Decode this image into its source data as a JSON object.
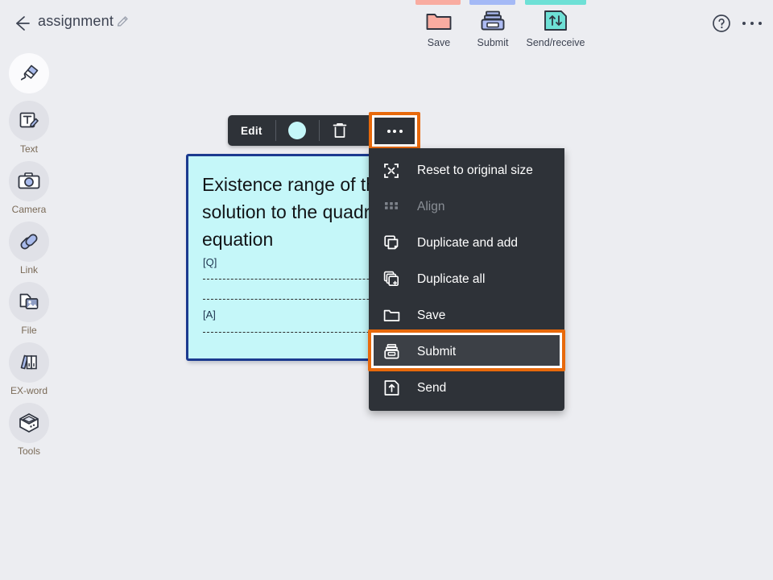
{
  "app": {
    "background_color": "#ecedf1",
    "accent_highlight_color": "#e8690b",
    "menu_background_color": "#2e3238"
  },
  "header": {
    "back_label": "back-arrow",
    "title": "assignment",
    "title_edit_icon": "pencil-icon",
    "help_icon": "help-circle-icon",
    "overflow_icon": "more-horizontal-icon",
    "stripes": [
      {
        "name": "save-stripe",
        "color": "#f9aca1"
      },
      {
        "name": "submit-stripe",
        "color": "#a4b9f6"
      },
      {
        "name": "send-receive-stripe",
        "color": "#6ee0d6"
      }
    ],
    "tools": [
      {
        "icon": "folder-icon",
        "label": "Save"
      },
      {
        "icon": "printer-icon",
        "label": "Submit"
      },
      {
        "icon": "send-receive-icon",
        "label": "Send/receive"
      }
    ]
  },
  "sidebar": {
    "items": [
      {
        "icon": "pen-icon",
        "label": "",
        "active": true
      },
      {
        "icon": "text-icon",
        "label": "Text",
        "active": false
      },
      {
        "icon": "camera-icon",
        "label": "Camera",
        "active": false
      },
      {
        "icon": "link-icon",
        "label": "Link",
        "active": false
      },
      {
        "icon": "file-icon",
        "label": "File",
        "active": false
      },
      {
        "icon": "dictionary-icon",
        "label": "EX-word",
        "active": false
      },
      {
        "icon": "tools-icon",
        "label": "Tools",
        "active": false
      }
    ]
  },
  "note": {
    "title": "Existence range of the solution to the quadratic equation",
    "question_label": "[Q]",
    "answer_label": "[A]",
    "fill_color": "#c5f7f9",
    "border_color": "#1b3a8f"
  },
  "edit_toolbar": {
    "edit_label": "Edit",
    "color_swatch": "#c5f7f9",
    "delete_icon": "trash-icon",
    "more_icon": "more-horizontal-icon",
    "more_highlighted": true
  },
  "context_menu": {
    "items": [
      {
        "icon": "reset-size-icon",
        "label": "Reset to original size",
        "disabled": false,
        "selected": false
      },
      {
        "icon": "grid-align-icon",
        "label": "Align",
        "disabled": true,
        "selected": false
      },
      {
        "icon": "duplicate-add-icon",
        "label": "Duplicate and add",
        "disabled": false,
        "selected": false
      },
      {
        "icon": "duplicate-all-icon",
        "label": "Duplicate all",
        "disabled": false,
        "selected": false
      },
      {
        "icon": "folder-icon",
        "label": "Save",
        "disabled": false,
        "selected": false
      },
      {
        "icon": "printer-icon",
        "label": "Submit",
        "disabled": false,
        "selected": true
      },
      {
        "icon": "send-icon",
        "label": "Send",
        "disabled": false,
        "selected": false
      }
    ]
  }
}
